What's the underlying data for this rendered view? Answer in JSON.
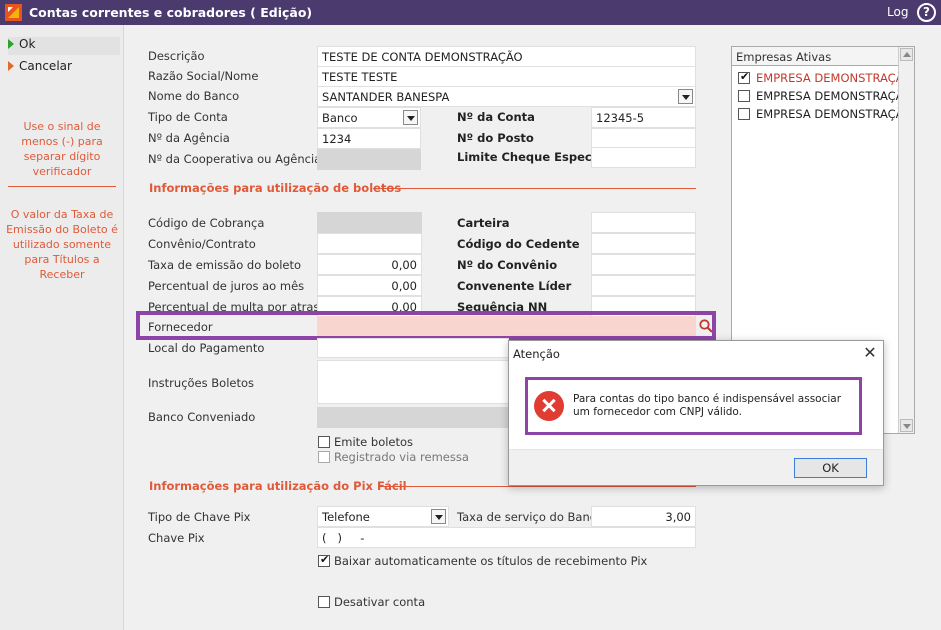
{
  "window": {
    "title": "Contas correntes e cobradores ( Edição)",
    "log_label": "Log",
    "help_symbol": "?"
  },
  "sidebar": {
    "ok_label": "Ok",
    "cancel_label": "Cancelar",
    "hint_minus": "Use o sinal de menos (-) para separar dígito verificador",
    "hint_tax": "O valor da Taxa de Emissão do Boleto é utilizado somente para Títulos a Receber"
  },
  "form": {
    "descricao": {
      "label": "Descrição",
      "value": "TESTE DE CONTA DEMONSTRAÇÃO"
    },
    "razao": {
      "label": "Razão Social/Nome",
      "value": "TESTE TESTE"
    },
    "banco": {
      "label": "Nome do Banco",
      "value": "SANTANDER BANESPA"
    },
    "tipo_conta": {
      "label": "Tipo de Conta",
      "value": "Banco"
    },
    "agencia": {
      "label": "Nº da Agência",
      "value": "1234"
    },
    "cooperativa": {
      "label": "Nº da Cooperativa ou Agência",
      "value": ""
    },
    "num_conta": {
      "label": "Nº da Conta",
      "value": "12345-5"
    },
    "num_posto": {
      "label": "Nº do Posto",
      "value": ""
    },
    "limite": {
      "label": "Limite Cheque Especial",
      "value": ""
    }
  },
  "boletos": {
    "section_title": "Informações para utilização de boletos",
    "codigo_cobranca": {
      "label": "Código de Cobrança",
      "value": ""
    },
    "convenio_contrato": {
      "label": "Convênio/Contrato",
      "value": ""
    },
    "taxa_emissao": {
      "label": "Taxa de emissão do boleto",
      "value": "0,00"
    },
    "juros": {
      "label": "Percentual de juros ao mês",
      "value": "0,00"
    },
    "multa": {
      "label": "Percentual de multa por atraso",
      "value": "0,00"
    },
    "carteira": {
      "label": "Carteira",
      "value": ""
    },
    "codigo_cedente": {
      "label": "Código do Cedente",
      "value": ""
    },
    "num_convenio": {
      "label": "Nº do Convênio",
      "value": ""
    },
    "convenente_lider": {
      "label": "Convenente Líder",
      "value": ""
    },
    "sequencia_nn": {
      "label": "Sequência NN",
      "value": ""
    },
    "fornecedor": {
      "label": "Fornecedor",
      "value": ""
    },
    "local_pagamento": {
      "label": "Local do Pagamento"
    },
    "instrucoes": {
      "label": "Instruções Boletos"
    },
    "banco_conveniado": {
      "label": "Banco Conveniado"
    },
    "emite_boletos": {
      "label": "Emite boletos",
      "checked": false
    },
    "registrado_remessa": {
      "label": "Registrado via remessa",
      "checked": false
    }
  },
  "pix": {
    "section_title": "Informações para utilização do Pix Fácil",
    "tipo_chave": {
      "label": "Tipo de Chave Pix",
      "value": "Telefone"
    },
    "taxa_servico": {
      "label": "Taxa de serviço do Banco",
      "value": "3,00"
    },
    "chave": {
      "label": "Chave Pix",
      "value": "(   )     -"
    },
    "baixar_auto": {
      "label": "Baixar automaticamente os títulos de recebimento Pix",
      "checked": true
    },
    "desativar": {
      "label": "Desativar conta",
      "checked": false
    }
  },
  "empresas": {
    "header": "Empresas Ativas",
    "items": [
      {
        "label": "EMPRESA DEMONSTRAÇÃO",
        "checked": true
      },
      {
        "label": "EMPRESA DEMONSTRAÇÃO",
        "checked": false
      },
      {
        "label": "EMPRESA DEMONSTRAÇÃO",
        "checked": false
      }
    ]
  },
  "dialog": {
    "title": "Atenção",
    "close_symbol": "✕",
    "message": "Para contas do tipo banco é indispensável associar um fornecedor com CNPJ válido.",
    "ok_label": "OK"
  },
  "colors": {
    "titlebar": "#4a3a6e",
    "accent": "#e05a3a",
    "highlight": "#8e44a6",
    "error": "#e03c31"
  }
}
